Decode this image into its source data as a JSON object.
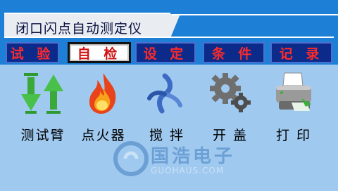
{
  "window": {
    "title": "闭口闪点自动测定仪"
  },
  "tabs": [
    {
      "label": "试 验",
      "active": false
    },
    {
      "label": "自 检",
      "active": true
    },
    {
      "label": "设 定",
      "active": false
    },
    {
      "label": "条 件",
      "active": false
    },
    {
      "label": "记 录",
      "active": false
    }
  ],
  "items": [
    {
      "label": "测试臂",
      "icon": "up-down-arrows-icon"
    },
    {
      "label": "点火器",
      "icon": "flame-icon"
    },
    {
      "label": "搅 拌",
      "icon": "stirrer-icon"
    },
    {
      "label": "开 盖",
      "icon": "gears-icon"
    },
    {
      "label": "打 印",
      "icon": "printer-icon"
    }
  ],
  "watermark": {
    "cn": "国浩电子",
    "en": "GUOHAUS.COM"
  },
  "colors": {
    "frame": "#1e7fd6",
    "content_bg": "#9fc9ef",
    "tab_bg": "#0b2a8a",
    "tab_text": "#ff2a2a"
  }
}
